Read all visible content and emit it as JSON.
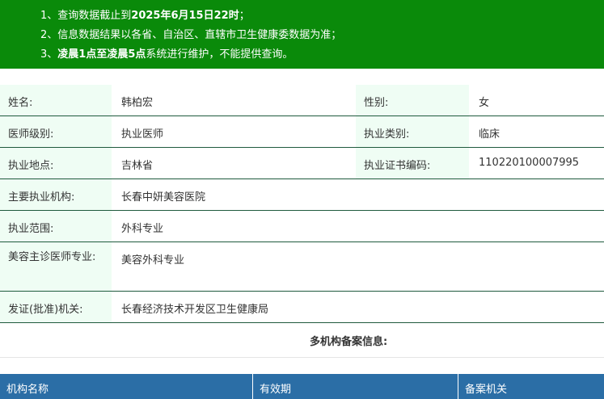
{
  "notice": {
    "line1_prefix": "1、查询数据截止到",
    "line1_bold": "2025年6月15日22时",
    "line1_suffix": "；",
    "line2": "2、信息数据结果以各省、自治区、直辖市卫生健康委数据为准；",
    "line3_prefix": "3、",
    "line3_bold": "凌晨1点至凌晨5点",
    "line3_suffix": "系统进行维护，不能提供查询。"
  },
  "doctor": {
    "name_label": "姓名:",
    "name": "韩柏宏",
    "gender_label": "性别:",
    "gender": "女",
    "level_label": "医师级别:",
    "level": "执业医师",
    "category_label": "执业类别:",
    "category": "临床",
    "location_label": "执业地点:",
    "location": "吉林省",
    "cert_label": "执业证书编码:",
    "cert": "110220100007995",
    "institution_label": "主要执业机构:",
    "institution": "长春中妍美容医院",
    "scope_label": "执业范围:",
    "scope": "外科专业",
    "cosmetic_label": "美容主诊医师专业:",
    "cosmetic": "美容外科专业",
    "issuer_label": "发证(批准)机关:",
    "issuer": "长春经济技术开发区卫生健康局"
  },
  "multi_title": "多机构备案信息:",
  "table_headers": [
    "机构名称",
    "有效期",
    "备案机关"
  ]
}
